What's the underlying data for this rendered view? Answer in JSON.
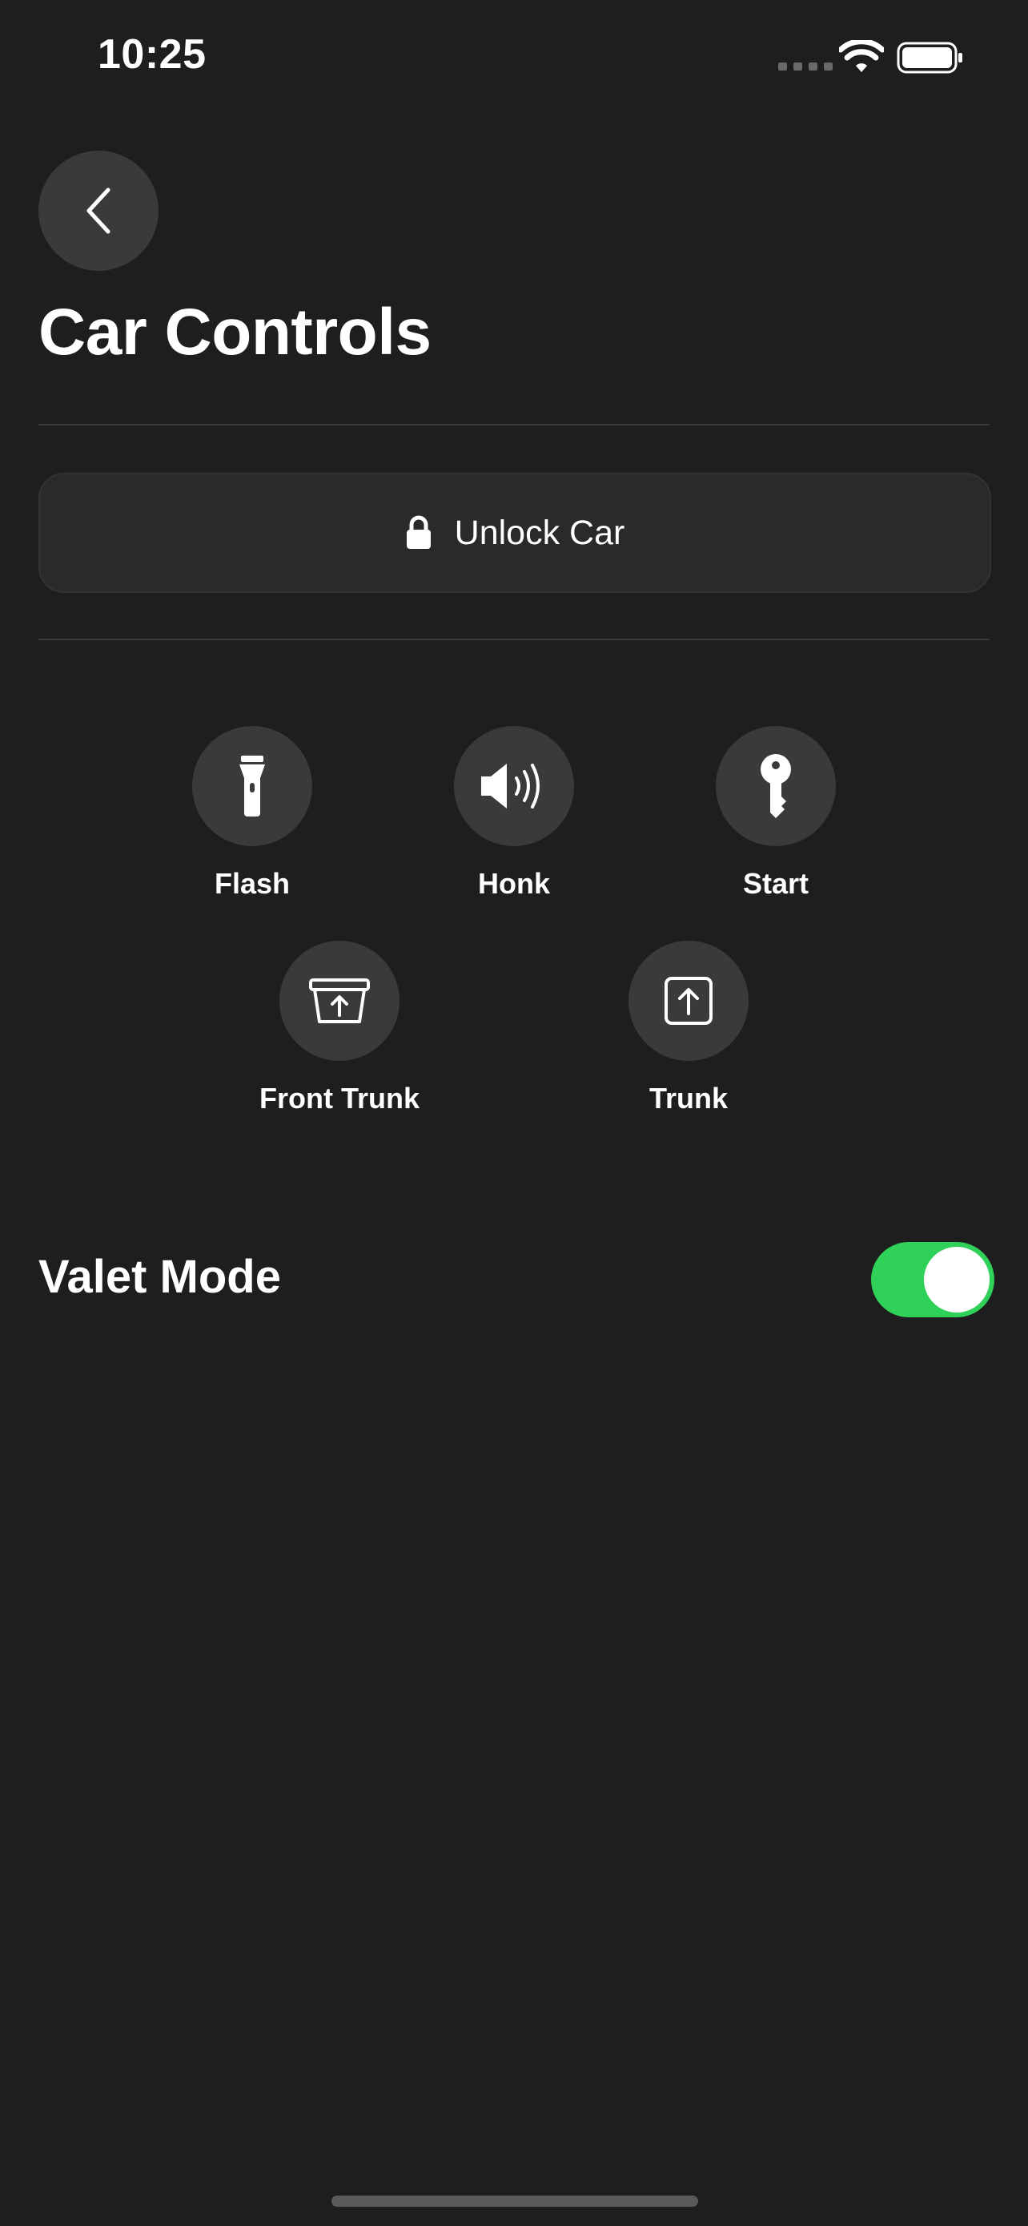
{
  "status_bar": {
    "time": "10:25"
  },
  "header": {
    "title": "Car Controls"
  },
  "unlock": {
    "label": "Unlock Car",
    "icon": "lock-icon"
  },
  "controls": [
    {
      "label": "Flash",
      "icon": "flashlight-icon"
    },
    {
      "label": "Honk",
      "icon": "speaker-icon"
    },
    {
      "label": "Start",
      "icon": "key-icon"
    },
    {
      "label": "Front Trunk",
      "icon": "front-trunk-icon"
    },
    {
      "label": "Trunk",
      "icon": "trunk-icon"
    }
  ],
  "valet": {
    "label": "Valet Mode",
    "enabled": true
  },
  "colors": {
    "background": "#1e1e1e",
    "button_fill": "#3a3a3a",
    "toggle_on": "#30d158"
  }
}
